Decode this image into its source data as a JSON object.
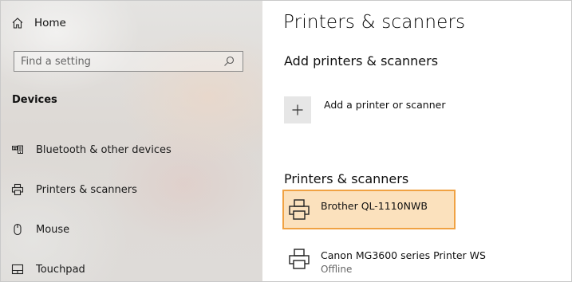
{
  "sidebar": {
    "home_label": "Home",
    "search_placeholder": "Find a setting",
    "section_title": "Devices",
    "items": [
      {
        "label": "Bluetooth & other devices",
        "icon": "bluetooth-devices-icon"
      },
      {
        "label": "Printers & scanners",
        "icon": "printer-icon"
      },
      {
        "label": "Mouse",
        "icon": "mouse-icon"
      },
      {
        "label": "Touchpad",
        "icon": "touchpad-icon"
      }
    ]
  },
  "main": {
    "title": "Printers & scanners",
    "add_section_heading": "Add printers & scanners",
    "add_button_label": "Add a printer or scanner",
    "list_heading": "Printers & scanners",
    "printers": [
      {
        "name": "Brother QL-1110NWB",
        "status": "",
        "selected": true
      },
      {
        "name": "Canon MG3600 series Printer WS",
        "status": "Offline",
        "selected": false
      }
    ]
  },
  "colors": {
    "highlight_fill": "#fbe1bd",
    "highlight_border": "#f0a243"
  }
}
